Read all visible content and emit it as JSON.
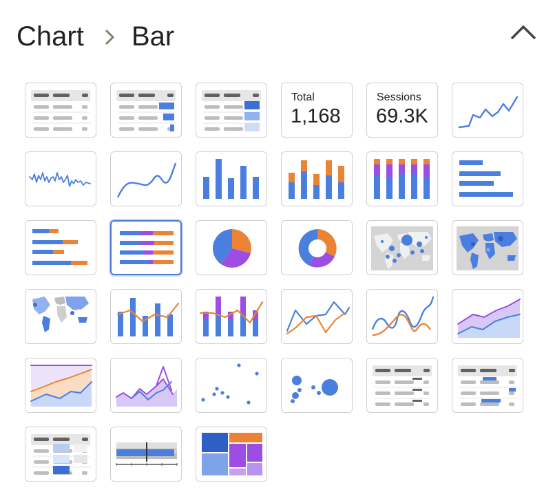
{
  "breadcrumb": {
    "parent": "Chart",
    "current": "Bar"
  },
  "header": {
    "collapse_icon": "chevron-up-icon"
  },
  "colors": {
    "blue": "#4a7fe0",
    "orange": "#ea8434",
    "purple": "#9b4de4",
    "grey": "#e6e6e6",
    "dark": "#616161",
    "light": "#bdbdbd",
    "selected_border": "#4a7bd8"
  },
  "scorecards": [
    {
      "label": "Total",
      "value": "1,168"
    },
    {
      "label": "Sessions",
      "value": "69.3K"
    }
  ],
  "chart_types": [
    "table",
    "table-bar",
    "table-heatmap",
    "scorecard-total",
    "scorecard-sessions",
    "sparkline",
    "time-series",
    "smooth-line",
    "column",
    "stacked-column",
    "100-stacked-column",
    "horizontal-bar",
    "stacked-bar",
    "100-stacked-bar",
    "pie",
    "donut",
    "bubble-map",
    "filled-map",
    "geo-map",
    "combo-column-line",
    "stacked-combo",
    "line",
    "smooth-line-multi",
    "area",
    "stacked-area",
    "100-area",
    "scatter",
    "bubble",
    "pivot-table",
    "pivot-table-bar",
    "pivot-table-heatmap",
    "bullet",
    "treemap"
  ],
  "selected_chart": "100-stacked-bar"
}
